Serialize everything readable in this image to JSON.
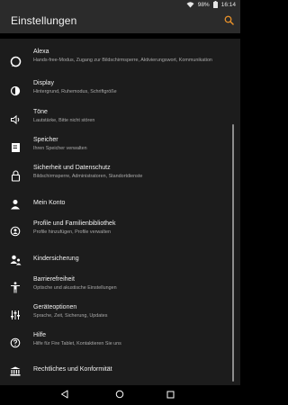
{
  "status_bar": {
    "battery": "98%",
    "time": "16:14",
    "icons": [
      "wifi-icon",
      "battery-icon"
    ]
  },
  "app_bar": {
    "title": "Einstellungen",
    "search_icon": "search-icon",
    "accent": "#e8912a"
  },
  "settings": [
    {
      "icon": "alexa-icon",
      "title": "Alexa",
      "subtitle": "Hands-free-Modus, Zugang zur Bildschirmsperre, Aktivierungswort, Kommunikation"
    },
    {
      "icon": "display-icon",
      "title": "Display",
      "subtitle": "Hintergrund, Ruhemodus, Schriftgröße"
    },
    {
      "icon": "sound-icon",
      "title": "Töne",
      "subtitle": "Lautstärke, Bitte nicht stören"
    },
    {
      "icon": "storage-icon",
      "title": "Speicher",
      "subtitle": "Ihren Speicher verwalten"
    },
    {
      "icon": "lock-icon",
      "title": "Sicherheit und Datenschutz",
      "subtitle": "Bildschirmsperre, Administratoren, Standortdienste"
    },
    {
      "icon": "account-icon",
      "title": "Mein Konto",
      "subtitle": ""
    },
    {
      "icon": "profiles-icon",
      "title": "Profile und Familienbibliothek",
      "subtitle": "Profile hinzufügen, Profile verwalten"
    },
    {
      "icon": "parental-controls-icon",
      "title": "Kindersicherung",
      "subtitle": ""
    },
    {
      "icon": "accessibility-icon",
      "title": "Barrierefreiheit",
      "subtitle": "Optische und akustische Einstellungen"
    },
    {
      "icon": "device-options-icon",
      "title": "Geräteoptionen",
      "subtitle": "Sprache, Zeit, Sicherung, Updates"
    },
    {
      "icon": "help-icon",
      "title": "Hilfe",
      "subtitle": "Hilfe für Fire Tablet, Kontaktieren Sie uns"
    },
    {
      "icon": "legal-icon",
      "title": "Rechtliches und Konformität",
      "subtitle": ""
    }
  ],
  "nav_bar": {
    "icons": [
      "back-icon",
      "home-icon",
      "recents-icon"
    ]
  }
}
